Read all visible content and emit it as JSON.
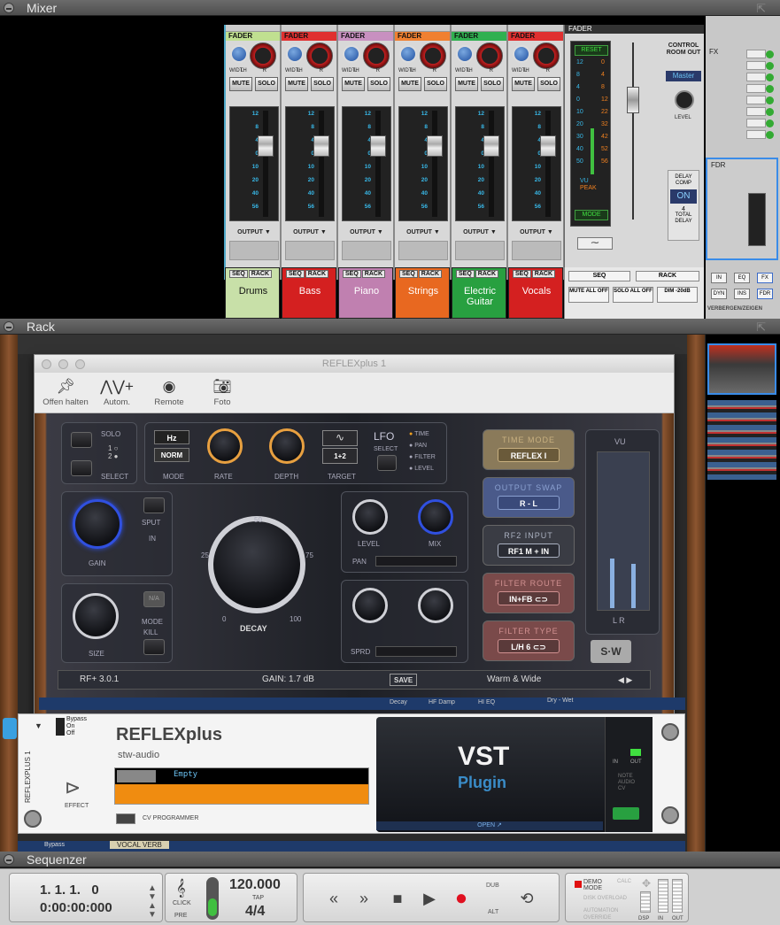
{
  "panels": {
    "mixer": "Mixer",
    "rack": "Rack",
    "sequencer": "Sequenzer"
  },
  "mixer": {
    "strip_labels": {
      "fader": "FADER",
      "width": "WIDTH",
      "lr": "L R",
      "mute": "MUTE",
      "solo": "SOLO",
      "output": "OUTPUT ▼",
      "top": "LEVEL"
    },
    "scale": [
      "12",
      "8",
      "4",
      "0",
      "10",
      "20",
      "40",
      "56"
    ],
    "channels": [
      {
        "name": "Drums",
        "color": "#c8e0a8",
        "text": "#111111",
        "fader_color": "#c0e090"
      },
      {
        "name": "Bass",
        "color": "#d42020",
        "text": "#ffffff",
        "fader_color": "#e03030"
      },
      {
        "name": "Piano",
        "color": "#c080b0",
        "text": "#ffffff",
        "fader_color": "#c890c0"
      },
      {
        "name": "Strings",
        "color": "#e86820",
        "text": "#ffffff",
        "fader_color": "#f08030"
      },
      {
        "name": "Electric Guitar",
        "color": "#28a040",
        "text": "#ffffff",
        "fader_color": "#30b050"
      },
      {
        "name": "Vocals",
        "color": "#d42020",
        "text": "#ffffff",
        "fader_color": "#e03030"
      }
    ],
    "seq": "SEQ",
    "rack": "RACK",
    "master": {
      "fader": "FADER",
      "reset": "RESET",
      "mode": "MODE",
      "vu": "VU",
      "peak": "PEAK",
      "control_room": "CONTROL ROOM OUT",
      "master_label": "Master",
      "level": "LEVEL",
      "delay_comp": "DELAY COMP",
      "on": "ON",
      "delay_value": "4",
      "total_delay": "TOTAL DELAY",
      "left_scale": [
        "12",
        "8",
        "4",
        "0",
        "10",
        "20",
        "30",
        "40",
        "50"
      ],
      "right_scale": [
        "0",
        "4",
        "8",
        "12",
        "22",
        "32",
        "42",
        "52",
        "56"
      ],
      "seq": "SEQ",
      "rack": "RACK",
      "mute_all": "MUTE ALL OFF",
      "solo_all": "SOLO ALL OFF",
      "dim": "DIM -20dB"
    },
    "fx": {
      "fx": "FX",
      "fdr": "FDR",
      "in": "IN",
      "eq": "EQ",
      "fx_btn": "FX",
      "dyn": "DYN",
      "ins": "INS",
      "fdr_btn": "FDR",
      "toggle": "VERBERGEN/ZEIGEN"
    }
  },
  "plugin_window": {
    "title": "REFLEXplus 1",
    "tools": [
      "Offen halten",
      "Autom.",
      "Remote",
      "Foto"
    ],
    "solo": "SOLO",
    "select": "SELECT",
    "mode": "MODE",
    "hz": "Hz",
    "norm": "NORM",
    "rate": "RATE",
    "depth": "DEPTH",
    "target": "TARGET",
    "target_val": "1+2",
    "lfo": "LFO",
    "lfo_select": "SELECT",
    "lfo_opts": [
      "TIME",
      "PAN",
      "FILTER",
      "LEVEL"
    ],
    "gain": "GAIN",
    "sput": "SPUT",
    "in": "IN",
    "size": "SIZE",
    "mode2": "MODE",
    "kill": "KILL",
    "na": "N/A",
    "decay": "DECAY",
    "decay_scale": [
      "0",
      "25",
      "50",
      "75",
      "100"
    ],
    "level": "LEVEL",
    "mix": "MIX",
    "pan": "PAN",
    "sprd": "SPRD",
    "routing": [
      {
        "title": "TIME MODE",
        "value": "REFLEX I"
      },
      {
        "title": "OUTPUT SWAP",
        "value": "R - L"
      },
      {
        "title": "RF2 INPUT",
        "value": "RF1 M + IN"
      },
      {
        "title": "FILTER ROUTE",
        "value": "IN+FB ⊂⊃"
      },
      {
        "title": "FILTER TYPE",
        "value": "L/H 6 ⊂⊃"
      }
    ],
    "vu": "VU",
    "vu_lr": "L  R",
    "status": {
      "version": "RF+ 3.0.1",
      "gain": "GAIN: 1.7 dB",
      "save": "SAVE",
      "preset": "Warm & Wide"
    }
  },
  "echo_labels": [
    "Decay",
    "HF Damp",
    "HI EQ",
    "Dry - Wet"
  ],
  "device": {
    "bypass": "Bypass",
    "on": "On",
    "off": "Off",
    "side_label": "REFLEXPLUS 1",
    "name": "REFLEXplus",
    "vendor": "stw-audio",
    "patch": "Empty",
    "effect": "EFFECT",
    "cv": "CV PROGRAMMER",
    "vst_line1": "VST",
    "vst_line2": "Plugin",
    "open": "OPEN ↗",
    "in": "IN",
    "out": "OUT",
    "note": "NOTE",
    "audio": "AUDIO",
    "cv2": "CV"
  },
  "echo_device": {
    "bypass": "Bypass",
    "name": "VOCAL VERB"
  },
  "sequencer": {
    "position_bars": "1. 1. 1.   0",
    "position_time": "0:00:00:000",
    "click": "CLICK",
    "pre": "PRE",
    "tempo": "120.000",
    "tap": "TAP",
    "signature": "4/4",
    "dub": "DUB",
    "alt": "ALT",
    "demo": "DEMO MODE",
    "calc": "CALC",
    "sync": "SYNC",
    "dsp": "DSP",
    "in": "IN",
    "out": "OUT",
    "side_labels": [
      "DISK OVERLOAD",
      "AUTOMATION OVERRIDE"
    ]
  }
}
